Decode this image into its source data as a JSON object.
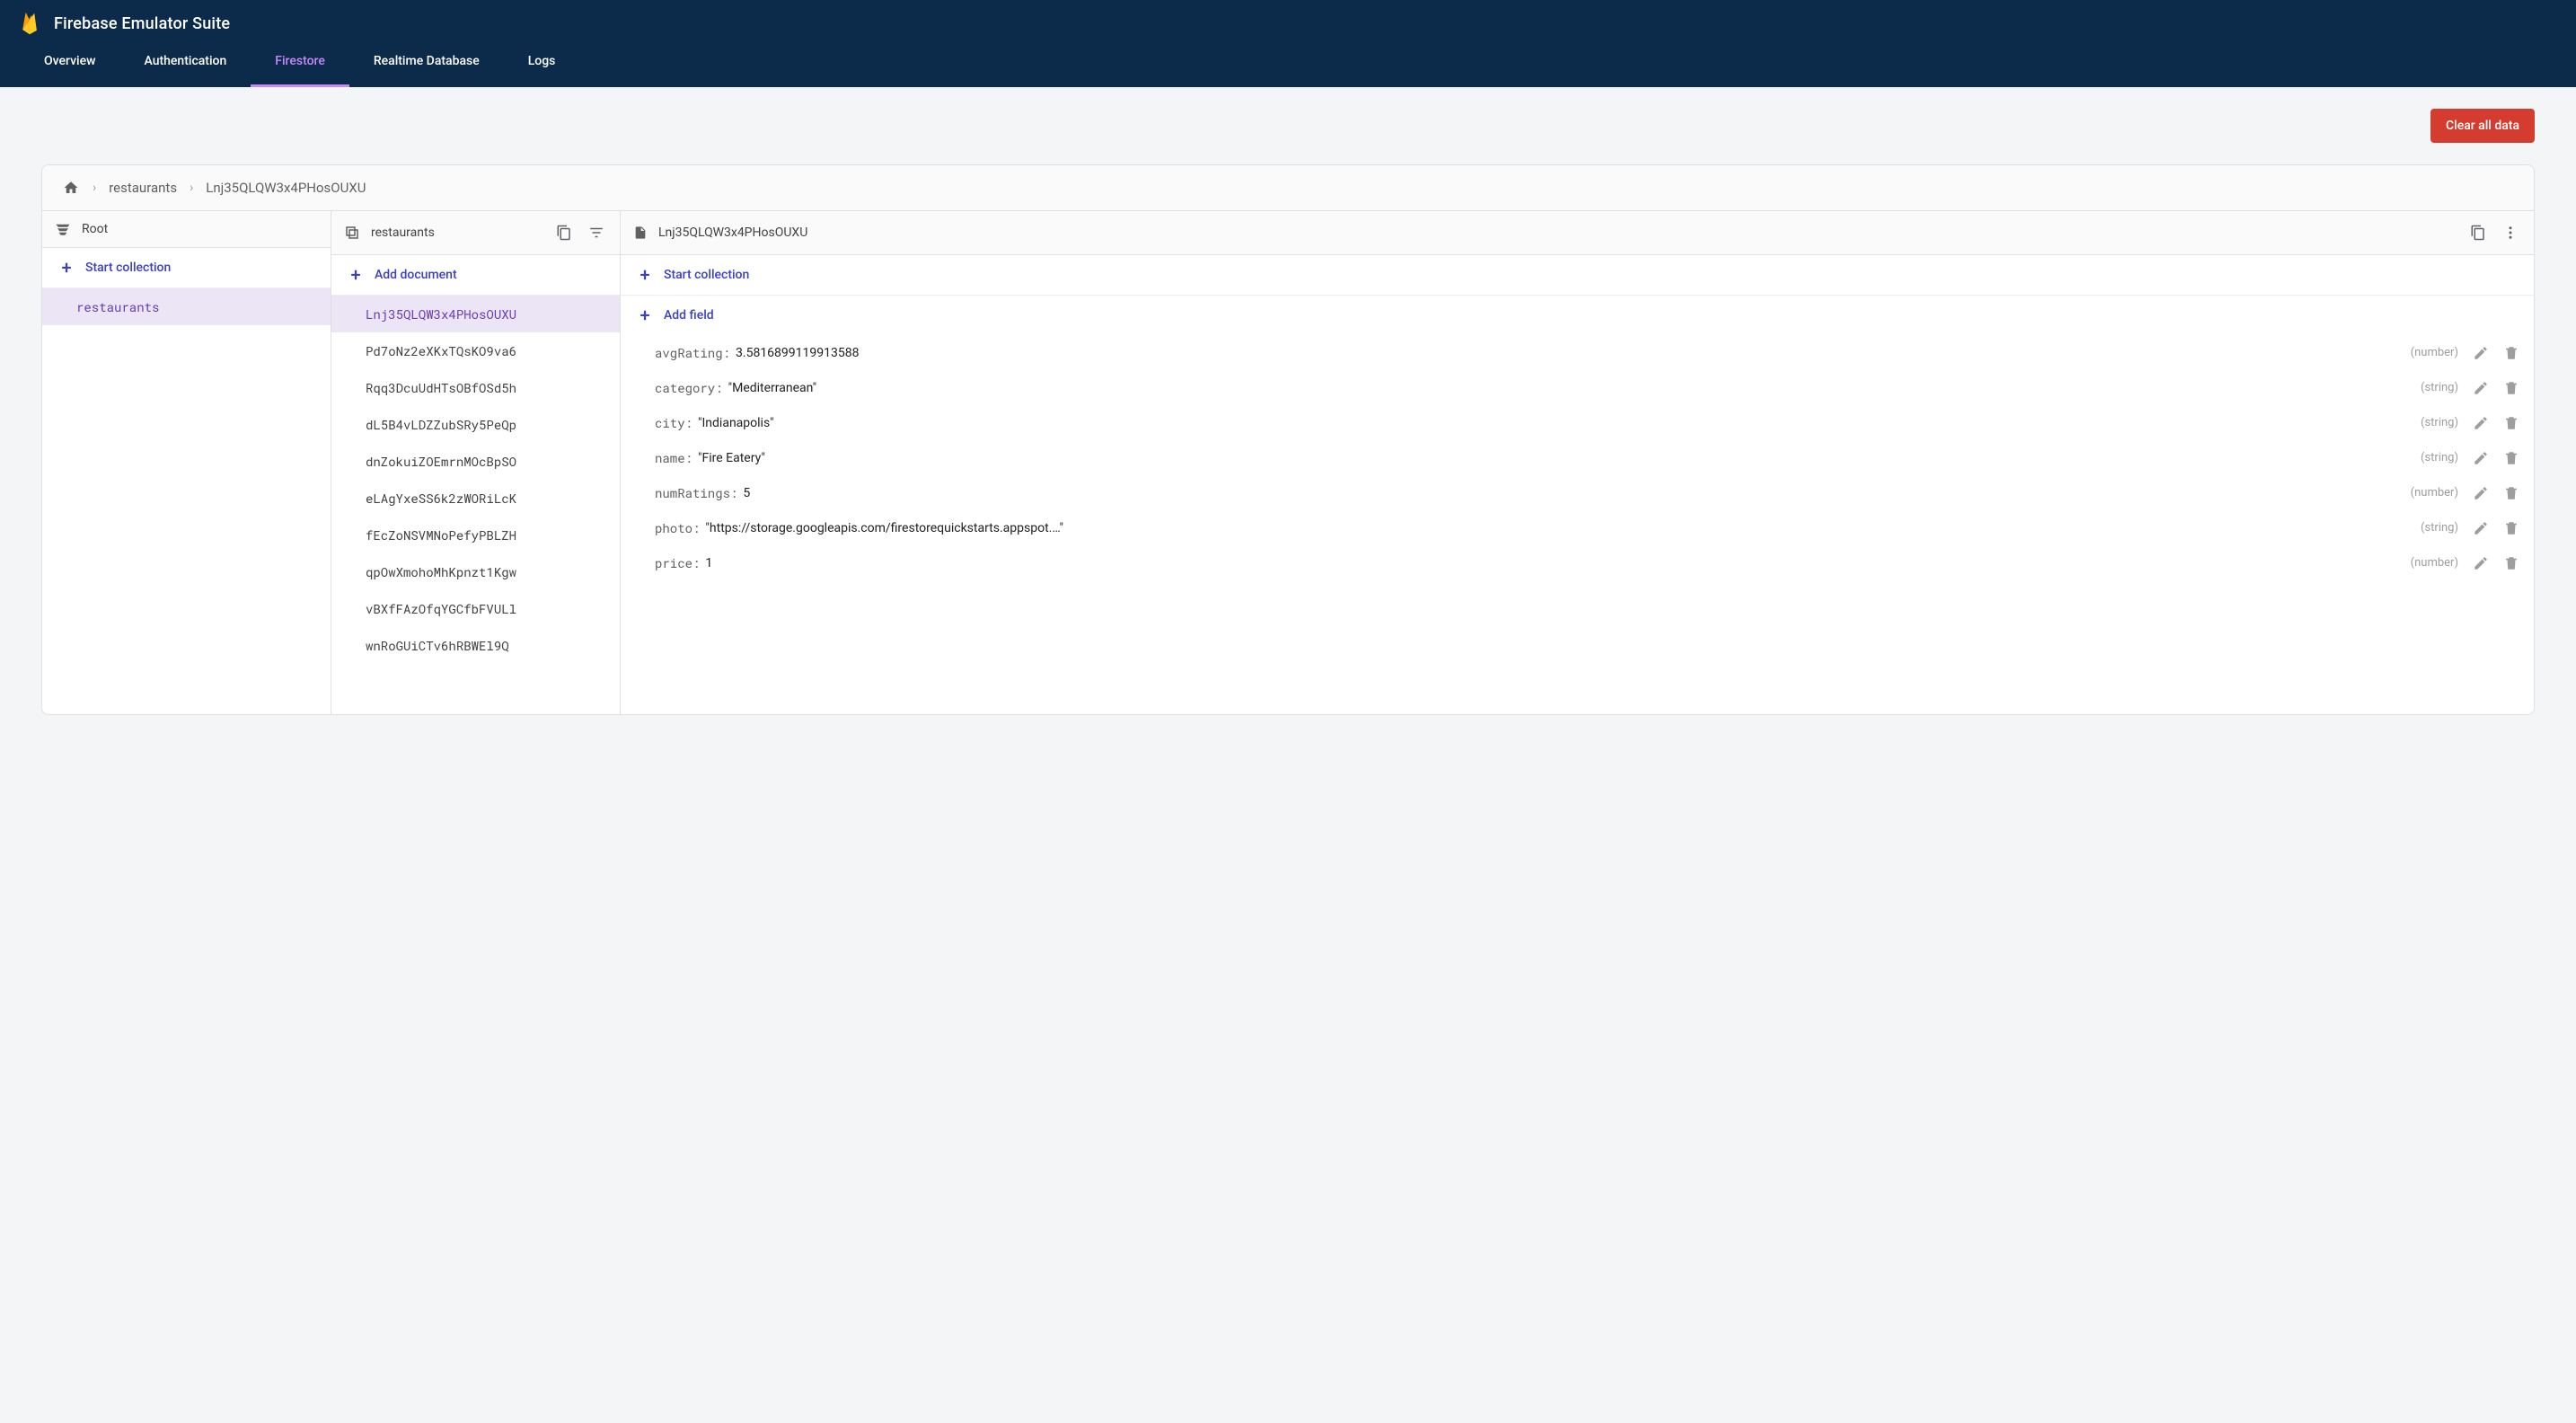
{
  "header": {
    "title": "Firebase Emulator Suite"
  },
  "nav": {
    "items": [
      "Overview",
      "Authentication",
      "Firestore",
      "Realtime Database",
      "Logs"
    ],
    "activeIndex": 2
  },
  "clearButton": "Clear all data",
  "breadcrumbs": {
    "items": [
      "restaurants",
      "Lnj35QLQW3x4PHosOUXU"
    ]
  },
  "panel1": {
    "title": "Root",
    "action": "Start collection",
    "items": [
      "restaurants"
    ],
    "selectedIndex": 0
  },
  "panel2": {
    "title": "restaurants",
    "action": "Add document",
    "items": [
      "Lnj35QLQW3x4PHosOUXU",
      "Pd7oNz2eXKxTQsKO9va6",
      "Rqq3DcuUdHTsOBfOSd5h",
      "dL5B4vLDZZubSRy5PeQp",
      "dnZokuiZOEmrnMOcBpSO",
      "eLAgYxeSS6k2zWORiLcK",
      "fEcZoNSVMNoPefyPBLZH",
      "qpOwXmohoMhKpnzt1Kgw",
      "vBXfFAzOfqYGCfbFVULl",
      "wnRoGUiCTv6hRBWEl9Q"
    ],
    "selectedIndex": 0
  },
  "panel3": {
    "title": "Lnj35QLQW3x4PHosOUXU",
    "action1": "Start collection",
    "action2": "Add field",
    "fields": [
      {
        "key": "avgRating",
        "value": "3.5816899119913588",
        "type": "(number)",
        "quoted": false
      },
      {
        "key": "category",
        "value": "Mediterranean",
        "type": "(string)",
        "quoted": true
      },
      {
        "key": "city",
        "value": "Indianapolis",
        "type": "(string)",
        "quoted": true
      },
      {
        "key": "name",
        "value": "Fire Eatery",
        "type": "(string)",
        "quoted": true
      },
      {
        "key": "numRatings",
        "value": "5",
        "type": "(number)",
        "quoted": false
      },
      {
        "key": "photo",
        "value": "https://storage.googleapis.com/firestorequickstarts.appspot.…",
        "type": "(string)",
        "quoted": true
      },
      {
        "key": "price",
        "value": "1",
        "type": "(number)",
        "quoted": false
      }
    ]
  }
}
